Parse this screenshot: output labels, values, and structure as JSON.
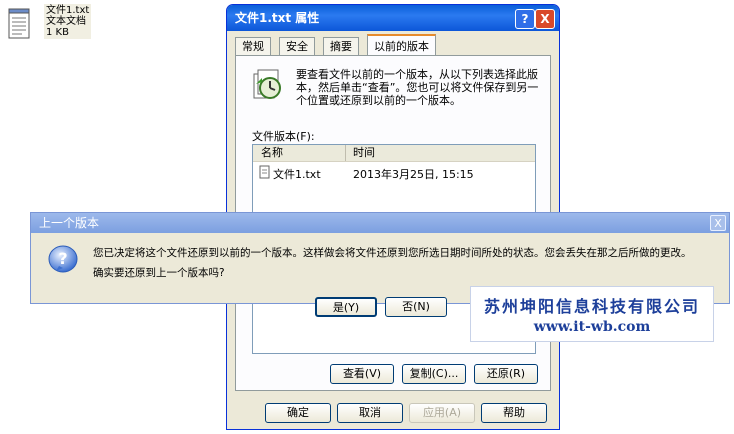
{
  "desktop_file": {
    "name": "文件1.txt",
    "type": "文本文档",
    "size": "1 KB"
  },
  "properties_window": {
    "title": "文件1.txt 属性",
    "help_button": "?",
    "close_button": "X",
    "tabs": [
      {
        "label": "常规"
      },
      {
        "label": "安全"
      },
      {
        "label": "摘要"
      },
      {
        "label": "以前的版本",
        "active": true
      }
    ],
    "description": "要查看文件以前的一个版本，从以下列表选择此版本，然后单击“查看”。您也可以将文件保存到另一个位置或还原到以前的一个版本。",
    "file_versions_label": "文件版本(F):",
    "columns": {
      "name": "名称",
      "time": "时间"
    },
    "versions": [
      {
        "name": "文件1.txt",
        "time": "2013年3月25日, 15:15"
      }
    ],
    "actions": {
      "view": "查看(V)",
      "copy": "复制(C)...",
      "restore": "还原(R)"
    },
    "footer": {
      "ok": "确定",
      "cancel": "取消",
      "apply": "应用(A)",
      "help": "帮助"
    }
  },
  "dialog": {
    "title": "上一个版本",
    "close": "X",
    "message_line1": "您已决定将这个文件还原到以前的一个版本。这样做会将文件还原到您所选日期时间所处的状态。您会丢失在那之后所做的更改。",
    "message_line2": "确实要还原到上一个版本吗?",
    "yes_button": "是(Y)",
    "no_button": "否(N)"
  },
  "watermark": {
    "company": "苏州坤阳信息科技有限公司",
    "url": "www.it-wb.com"
  }
}
